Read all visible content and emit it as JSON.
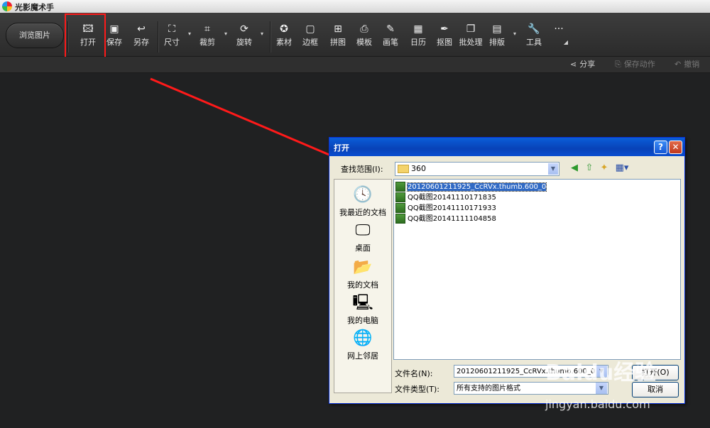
{
  "app": {
    "title": "光影魔术手"
  },
  "toolbar": {
    "browse_label": "浏览图片",
    "tools": [
      {
        "name": "open",
        "label": "打开",
        "icon": "image-plus-icon",
        "glyph": "🖾"
      },
      {
        "name": "save",
        "label": "保存",
        "icon": "save-icon",
        "glyph": "▣"
      },
      {
        "name": "save-as",
        "label": "另存",
        "icon": "save-as-icon",
        "glyph": "↩"
      },
      {
        "name": "size",
        "label": "尺寸",
        "icon": "resize-icon",
        "glyph": "⛶"
      },
      {
        "name": "crop",
        "label": "裁剪",
        "icon": "crop-icon",
        "glyph": "⌗"
      },
      {
        "name": "rotate",
        "label": "旋转",
        "icon": "rotate-icon",
        "glyph": "⟳"
      },
      {
        "name": "material",
        "label": "素材",
        "icon": "sticker-icon",
        "glyph": "✪"
      },
      {
        "name": "border",
        "label": "边框",
        "icon": "frame-icon",
        "glyph": "▢"
      },
      {
        "name": "collage",
        "label": "拼图",
        "icon": "grid-icon",
        "glyph": "⊞"
      },
      {
        "name": "template",
        "label": "模板",
        "icon": "printer-icon",
        "glyph": "⎙"
      },
      {
        "name": "brush",
        "label": "画笔",
        "icon": "brush-icon",
        "glyph": "✎"
      },
      {
        "name": "calendar",
        "label": "日历",
        "icon": "calendar-icon",
        "glyph": "▦"
      },
      {
        "name": "cutout",
        "label": "抠图",
        "icon": "pen-icon",
        "glyph": "✒"
      },
      {
        "name": "batch",
        "label": "批处理",
        "icon": "batch-icon",
        "glyph": "❐"
      },
      {
        "name": "layout",
        "label": "排版",
        "icon": "layout-icon",
        "glyph": "▤"
      },
      {
        "name": "tools",
        "label": "工具",
        "icon": "wrench-icon",
        "glyph": "🔧"
      },
      {
        "name": "more",
        "label": "",
        "icon": "more-icon",
        "glyph": "···"
      }
    ]
  },
  "subbar": {
    "share": "分享",
    "save_action": "保存动作",
    "undo": "撤销"
  },
  "dialog": {
    "title": "打开",
    "help": "?",
    "close": "✕",
    "look_in_label": "查找范围(I):",
    "look_in_value": "360",
    "places": [
      "我最近的文档",
      "桌面",
      "我的文档",
      "我的电脑",
      "网上邻居"
    ],
    "files": [
      "20120601211925_CcRVx.thumb.600_0",
      "QQ截图20141110171835",
      "QQ截图20141110171933",
      "QQ截图20141111104858"
    ],
    "filename_label": "文件名(N):",
    "filename_value": "20120601211925_CcRVx.thumb.600_0",
    "filetype_label": "文件类型(T):",
    "filetype_value": "所有支持的图片格式",
    "open_btn": "打开(O)",
    "cancel_btn": "取消"
  },
  "watermark": {
    "logo": "Baidu经验",
    "url": "jingyan.baidu.com"
  },
  "colors": {
    "highlight": "#ff1a1a",
    "arrow": "#ff1a1a",
    "xp_blue": "#0a5ed8"
  }
}
